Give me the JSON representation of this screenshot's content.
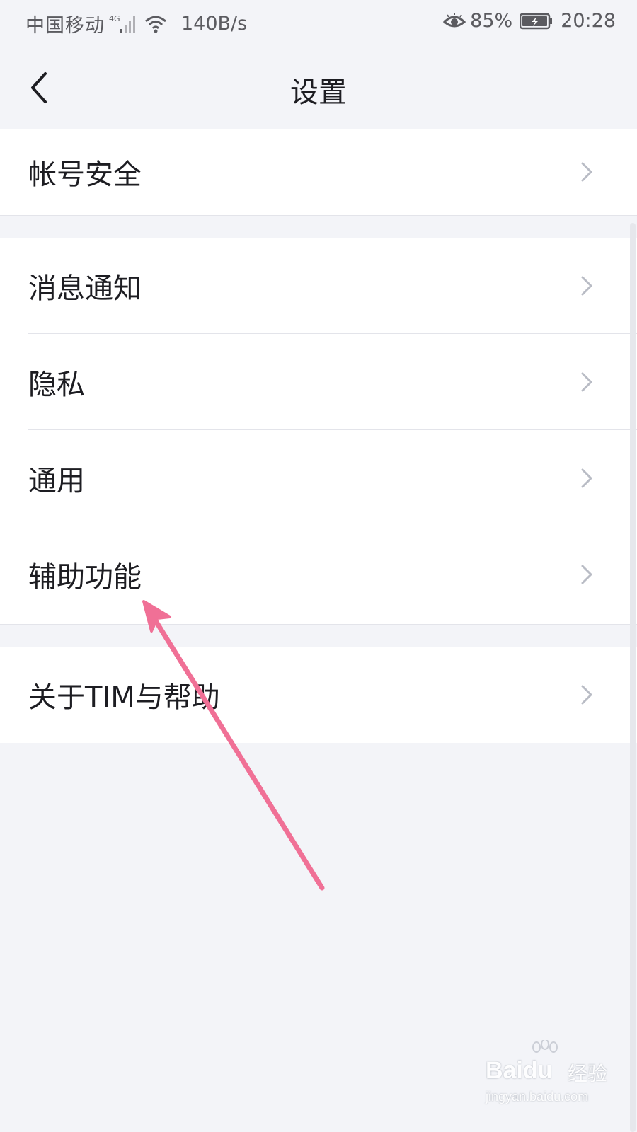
{
  "status_bar": {
    "carrier": "中国移动",
    "network_type": "4G",
    "speed": "140B/s",
    "battery_percent": "85%",
    "time": "20:28",
    "icons": [
      "signal-icon",
      "wifi-icon",
      "eye-icon",
      "battery-icon"
    ]
  },
  "nav": {
    "title": "设置",
    "back_icon": "back-chevron-icon"
  },
  "groups": [
    {
      "items": [
        {
          "label": "帐号安全"
        }
      ]
    },
    {
      "items": [
        {
          "label": "消息通知"
        },
        {
          "label": "隐私"
        },
        {
          "label": "通用"
        },
        {
          "label": "辅助功能"
        }
      ]
    },
    {
      "items": [
        {
          "label": "关于TIM与帮助"
        }
      ]
    }
  ],
  "annotation": {
    "type": "arrow",
    "color": "#f07096",
    "points_to": "辅助功能"
  },
  "watermark": {
    "logo": "Baidu",
    "logo_cn": "经验",
    "url": "jingyan.baidu.com"
  },
  "colors": {
    "background": "#f3f4f8",
    "row_background": "#ffffff",
    "text": "#1d1d22",
    "chevron": "#b9bcc5"
  }
}
